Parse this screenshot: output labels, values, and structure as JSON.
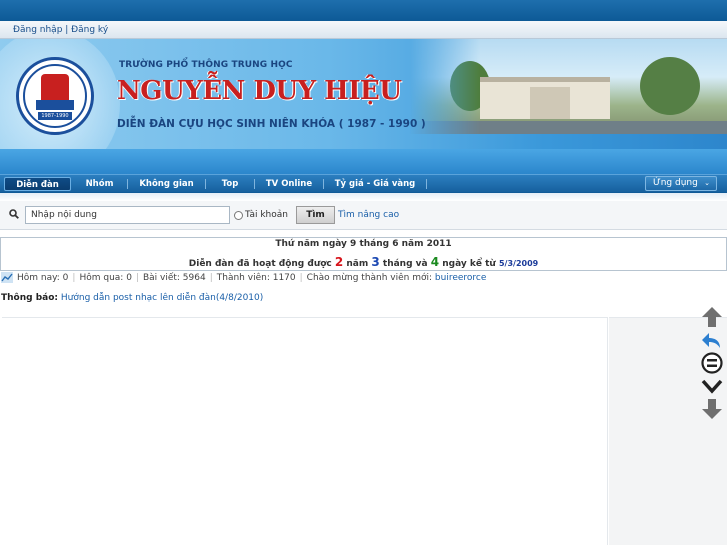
{
  "login": {
    "label": "Đăng nhập | Đăng ký"
  },
  "banner": {
    "school_sub": "TRƯỜNG PHỔ THÔNG TRUNG HỌC",
    "school_name": "NGUYỄN DUY HIỆU",
    "tagline": "DIỄN ĐÀN CỰU HỌC SINH NIÊN KHÓA ( 1987 - 1990 )",
    "logo_years": "1987-1990"
  },
  "nav": {
    "items": [
      {
        "label": "Diễn đàn"
      },
      {
        "label": "Nhóm"
      },
      {
        "label": "Không gian"
      },
      {
        "label": "Top"
      },
      {
        "label": "TV Online"
      },
      {
        "label": "Tỷ giá - Giá vàng"
      }
    ],
    "apps_label": "Ứng dụng"
  },
  "search": {
    "placeholder": "Nhập nội dung",
    "account_option": "Tài khoản",
    "button": "Tìm",
    "advanced": "Tìm nâng cao"
  },
  "date": {
    "today": "Thứ năm ngày 9 tháng 6 năm 2011",
    "age_prefix": "Diễn đàn đã hoạt động được",
    "years": "2",
    "years_unit": "năm",
    "months": "3",
    "months_unit": "tháng và",
    "days": "4",
    "days_unit": "ngày kể từ",
    "since": "5/3/2009"
  },
  "stats": {
    "today": "Hôm nay: 0",
    "yesterday": "Hôm qua: 0",
    "posts": "Bài viết: 5964",
    "members": "Thành viên: 1170",
    "welcome": "Chào mừng thành viên mới:",
    "newest_member": "buireerorce"
  },
  "notice": {
    "label": "Thông báo:",
    "text": "Hướng dẫn post nhạc lên diễn đàn(4/8/2010)"
  },
  "colors": {
    "nav_blue": "#16609e",
    "school_red": "#c8201f",
    "link_blue": "#1a5fa8"
  }
}
